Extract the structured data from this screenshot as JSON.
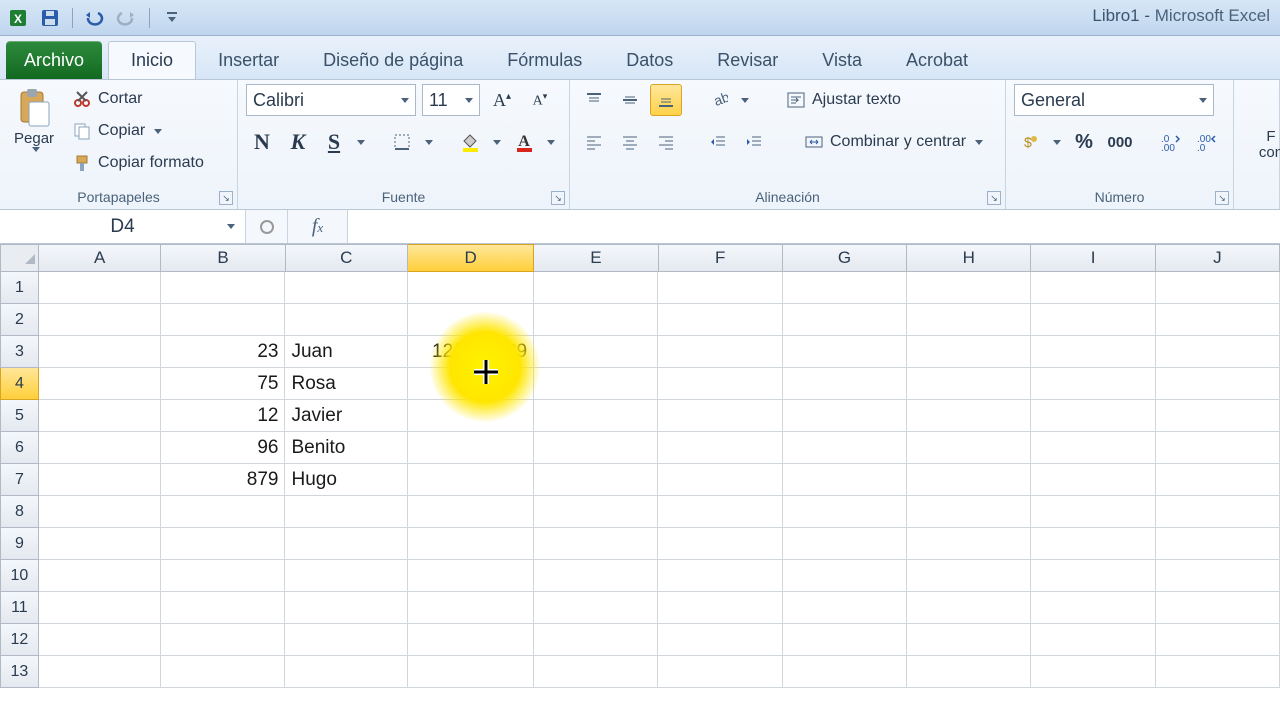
{
  "window": {
    "doc": "Libro1",
    "app": "Microsoft Excel"
  },
  "tabs": {
    "file": "Archivo",
    "list": [
      "Inicio",
      "Insertar",
      "Diseño de página",
      "Fórmulas",
      "Datos",
      "Revisar",
      "Vista",
      "Acrobat"
    ],
    "active": "Inicio"
  },
  "ribbon": {
    "clipboard": {
      "title": "Portapapeles",
      "paste": "Pegar",
      "cut": "Cortar",
      "copy": "Copiar",
      "format_painter": "Copiar formato"
    },
    "font": {
      "title": "Fuente",
      "name": "Calibri",
      "size": "11",
      "bold": "N",
      "italic": "K",
      "underline": "S"
    },
    "alignment": {
      "title": "Alineación",
      "wrap": "Ajustar texto",
      "merge": "Combinar y centrar"
    },
    "number": {
      "title": "Número",
      "format": "General",
      "percent": "%",
      "thousands": "000",
      "inc_dec": "⁰⁰",
      "dec_dec": "⁰⁰"
    },
    "truncated_right": "F\ncon"
  },
  "formula_bar": {
    "name_box": "D4",
    "formula": ""
  },
  "grid": {
    "columns": [
      "A",
      "B",
      "C",
      "D",
      "E",
      "F",
      "G",
      "H",
      "I",
      "J"
    ],
    "active_col": "D",
    "active_row": 4,
    "rows": [
      1,
      2,
      3,
      4,
      5,
      6,
      7,
      8,
      9,
      10,
      11,
      12,
      13
    ],
    "data": {
      "B3": "23",
      "C3": "Juan",
      "D3": "12/01/1989",
      "B4": "75",
      "C4": "Rosa",
      "B5": "12",
      "C5": "Javier",
      "B6": "96",
      "C6": "Benito",
      "B7": "879",
      "C7": "Hugo"
    },
    "selected_cell": "D4"
  }
}
